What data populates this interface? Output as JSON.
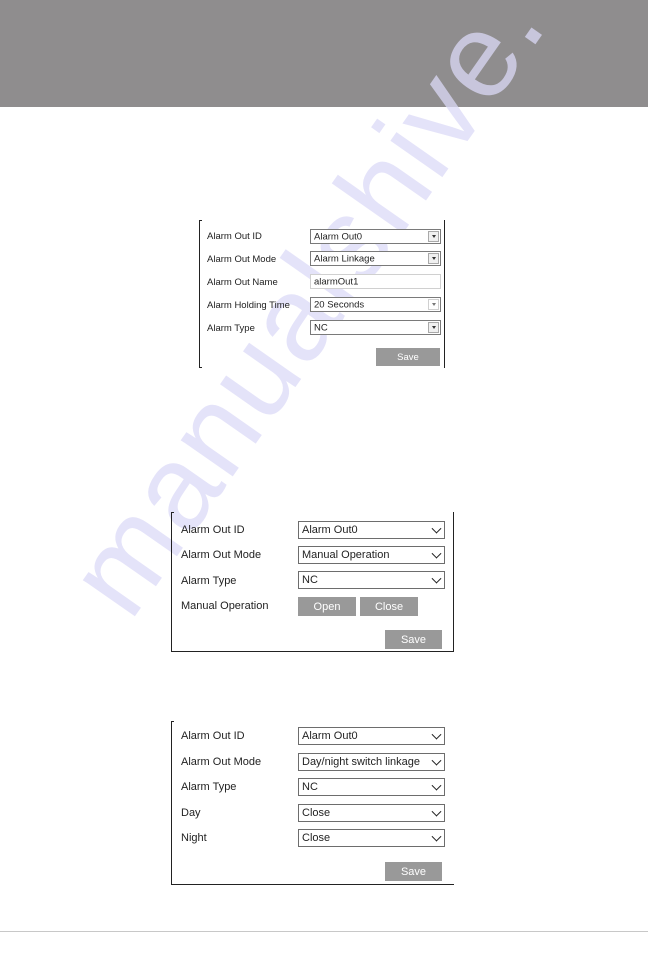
{
  "watermark": "manualshive.",
  "panels": {
    "linkage": {
      "rows": [
        {
          "label": "Alarm Out ID",
          "type": "select",
          "value": "Alarm Out0"
        },
        {
          "label": "Alarm Out Mode",
          "type": "select",
          "value": "Alarm Linkage"
        },
        {
          "label": "Alarm Out Name",
          "type": "text",
          "value": "alarmOut1"
        },
        {
          "label": "Alarm Holding Time",
          "type": "select",
          "value": "20 Seconds"
        },
        {
          "label": "Alarm Type",
          "type": "select",
          "value": "NC"
        }
      ],
      "save_label": "Save"
    },
    "manual": {
      "rows": [
        {
          "label": "Alarm Out ID",
          "type": "select",
          "value": "Alarm Out0"
        },
        {
          "label": "Alarm Out Mode",
          "type": "select",
          "value": "Manual Operation"
        },
        {
          "label": "Alarm Type",
          "type": "select",
          "value": "NC"
        },
        {
          "label": "Manual Operation",
          "type": "buttons"
        }
      ],
      "open_label": "Open",
      "close_label": "Close",
      "save_label": "Save"
    },
    "daynight": {
      "rows": [
        {
          "label": "Alarm Out ID",
          "type": "select",
          "value": "Alarm Out0"
        },
        {
          "label": "Alarm Out Mode",
          "type": "select",
          "value": "Day/night switch linkage"
        },
        {
          "label": "Alarm Type",
          "type": "select",
          "value": "NC"
        },
        {
          "label": "Day",
          "type": "select",
          "value": "Close"
        },
        {
          "label": "Night",
          "type": "select",
          "value": "Close"
        }
      ],
      "save_label": "Save"
    }
  }
}
